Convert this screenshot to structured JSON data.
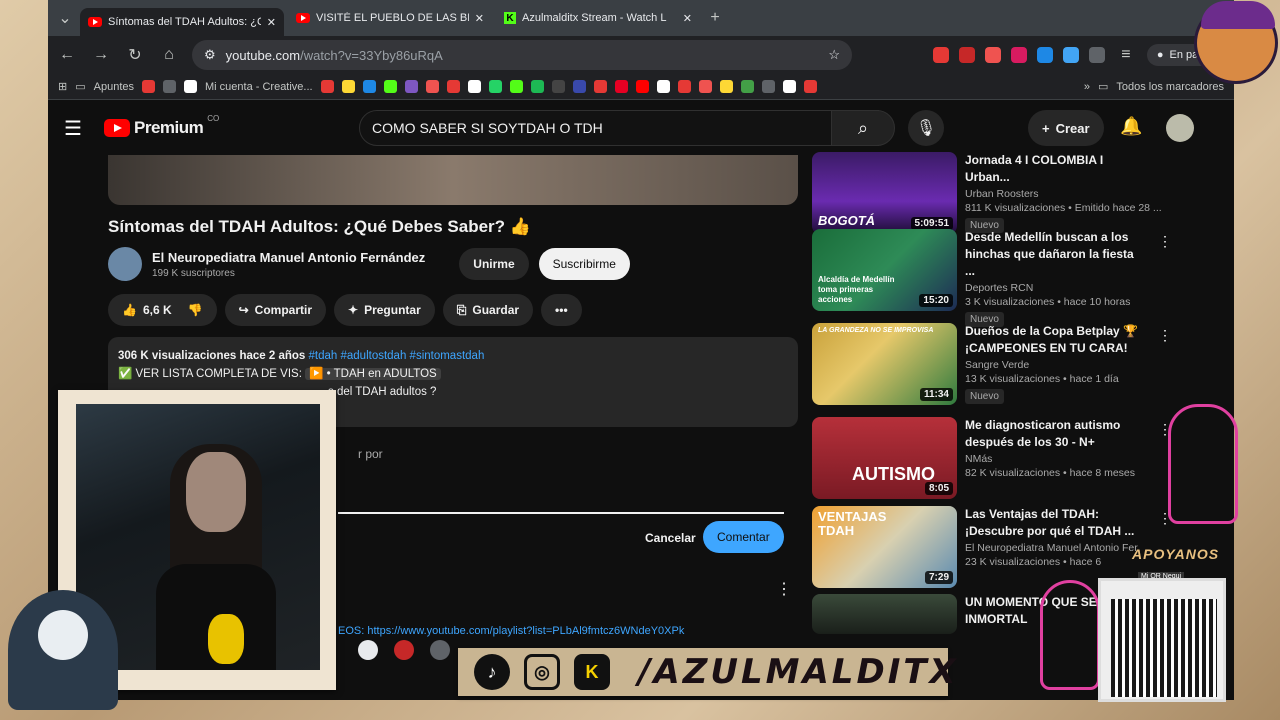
{
  "browser": {
    "tabs": [
      {
        "title": "Síntomas del TDAH Adultos: ¿Q",
        "icon": "youtube-icon"
      },
      {
        "title": "VISITÉ EL PUEBLO DE LAS BRUJ",
        "icon": "youtube-icon"
      },
      {
        "title": "Azulmalditx Stream - Watch L",
        "icon": "kick-icon"
      }
    ],
    "url_domain": "youtube.com",
    "url_path": "/watch?v=33Yby86uRqA",
    "profile_status": "En pausa",
    "bookmarks": [
      {
        "label": "Apuntes"
      },
      {
        "label": "Mi cuenta - Creative..."
      }
    ],
    "all_bookmarks": "Todos los marcadores"
  },
  "youtube": {
    "logo_text": "Premium",
    "logo_country": "CO",
    "search_query": "COMO SABER SI SOYTDAH O TDH",
    "create_label": "Crear",
    "video": {
      "title": "Síntomas del TDAH Adultos: ¿Qué Debes Saber? 👍",
      "channel": "El Neuropediatra Manuel Antonio Fernández",
      "subscribers": "199 K suscriptores",
      "join_label": "Unirme",
      "subscribe_label": "Suscribirme",
      "likes": "6,6 K",
      "share_label": "Compartir",
      "ask_label": "Preguntar",
      "save_label": "Guardar",
      "views": "306 K visualizaciones",
      "age": "hace 2 años",
      "tags": "#tdah #adultostdah #sintomastdah",
      "desc_line1_a": "✅ VER LISTA COMPLETA DE VI",
      "desc_line1_b": "S: ",
      "desc_line1_c": "▶️ • TDAH en ADULTOS",
      "desc_line2": "s del TDAH adultos ?",
      "comment_partial": "r por",
      "link_partial": "EOS: https://www.youtube.com/playlist?list=PLbAl9fmtcz6WNdeY0XPk",
      "cancel_label": "Cancelar",
      "comment_label": "Comentar"
    },
    "recommendations": [
      {
        "title": "Jornada 4 I COLOMBIA I Urban...",
        "channel": "Urban Roosters",
        "meta": "811 K visualizaciones • Emitido hace 28 ...",
        "badge": "Nuevo",
        "duration": "5:09:51",
        "thumb_text": "BOGOTÁ"
      },
      {
        "title": "Desde Medellín buscan a los hinchas que dañaron la fiesta ...",
        "channel": "Deportes RCN",
        "meta": "3 K visualizaciones • hace 10 horas",
        "badge": "Nuevo",
        "duration": "15:20",
        "thumb_text": "Alcaldía de Medellín toma primeras acciones"
      },
      {
        "title": "Dueños de la Copa Betplay 🏆 ¡CAMPEONES EN TU CARA!",
        "channel": "Sangre Verde",
        "meta": "13 K visualizaciones • hace 1 día",
        "badge": "Nuevo",
        "duration": "11:34",
        "thumb_text": "LA GRANDEZA NO SE IMPROVISA"
      },
      {
        "title": "Me diagnosticaron autismo después de los 30 - N+",
        "channel": "NMás",
        "meta": "82 K visualizaciones • hace 8 meses",
        "badge": "",
        "duration": "8:05",
        "thumb_text": "AUTISMO"
      },
      {
        "title": "Las Ventajas del TDAH: ¡Descubre por qué el TDAH ...",
        "channel": "El Neuropediatra Manuel Antonio Fer",
        "meta": "23 K visualizaciones • hace 6",
        "badge": "",
        "duration": "7:29",
        "thumb_text": "VENTAJAS TDAH"
      },
      {
        "title": "UN MOMENTO QUE SE INMORTAL",
        "channel": "",
        "meta": "",
        "badge": "",
        "duration": "",
        "thumb_text": ""
      }
    ]
  },
  "overlay": {
    "banner_text": "/AZULMALDITX",
    "apoyanos": "APOYANOS",
    "qr_label": "Mi QR Nequi"
  }
}
